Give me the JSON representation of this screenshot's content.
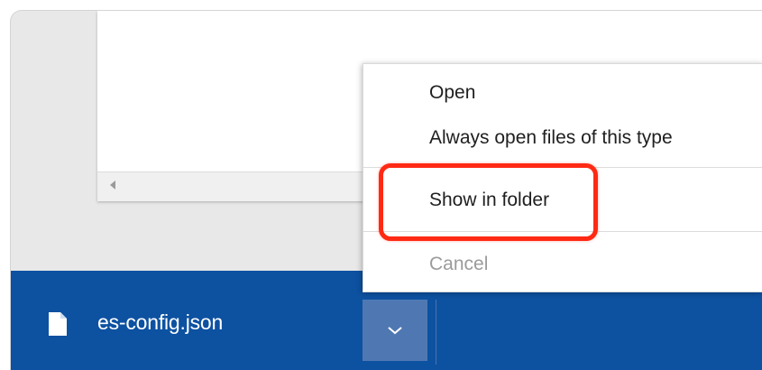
{
  "download_bar": {
    "file_name": "es-config.json",
    "file_icon": "document-icon",
    "options_icon": "chevron-down-icon",
    "background_color": "#0d51a1"
  },
  "context_menu": {
    "items": [
      {
        "label": "Open",
        "enabled": true
      },
      {
        "label": "Always open files of this type",
        "enabled": true
      },
      {
        "label": "Show in folder",
        "enabled": true,
        "highlighted": true
      },
      {
        "label": "Cancel",
        "enabled": false
      }
    ]
  },
  "page": {
    "scroll_left_icon": "scroll-left-arrow-icon"
  },
  "annotation": {
    "highlight_color": "#ff2a14"
  }
}
